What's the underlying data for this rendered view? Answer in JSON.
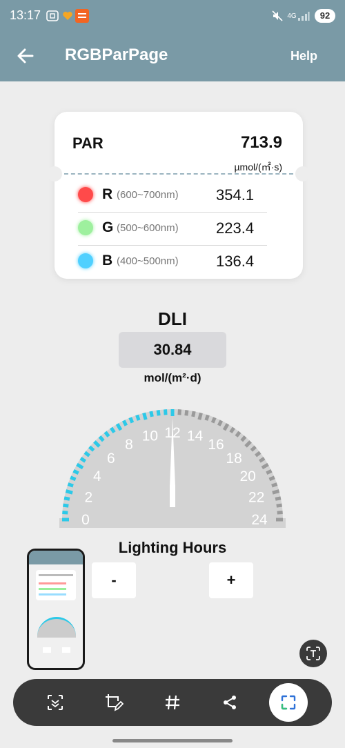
{
  "status_bar": {
    "time": "13:17",
    "network": "4G",
    "battery": "92"
  },
  "app_bar": {
    "title": "RGBParPage",
    "help_label": "Help"
  },
  "par_card": {
    "label": "PAR",
    "value": "713.9",
    "unit": "µmol/(㎡·s)",
    "channels": [
      {
        "letter": "R",
        "range": "(600~700nm)",
        "value": "354.1",
        "color": "#ff4a4a"
      },
      {
        "letter": "G",
        "range": "(500~600nm)",
        "value": "223.4",
        "color": "#9ef09e"
      },
      {
        "letter": "B",
        "range": "(400~500nm)",
        "value": "136.4",
        "color": "#4fd0ff"
      }
    ]
  },
  "dli": {
    "title": "DLI",
    "value": "30.84",
    "unit": "mol/(m²·d)"
  },
  "gauge": {
    "tick_labels": [
      "0",
      "2",
      "4",
      "6",
      "8",
      "10",
      "12",
      "14",
      "16",
      "18",
      "20",
      "22",
      "24"
    ],
    "min": 0,
    "max": 24,
    "current_hours": 12,
    "active_color": "#2cc9e8",
    "inactive_color": "#9a9a9a"
  },
  "lighting_hours": {
    "title": "Lighting Hours",
    "decrement_label": "-",
    "increment_label": "+"
  },
  "toolbar": {
    "tools": [
      "scan-icon",
      "edit-crop-icon",
      "hash-icon",
      "share-icon",
      "screenshot-frame-icon"
    ]
  }
}
